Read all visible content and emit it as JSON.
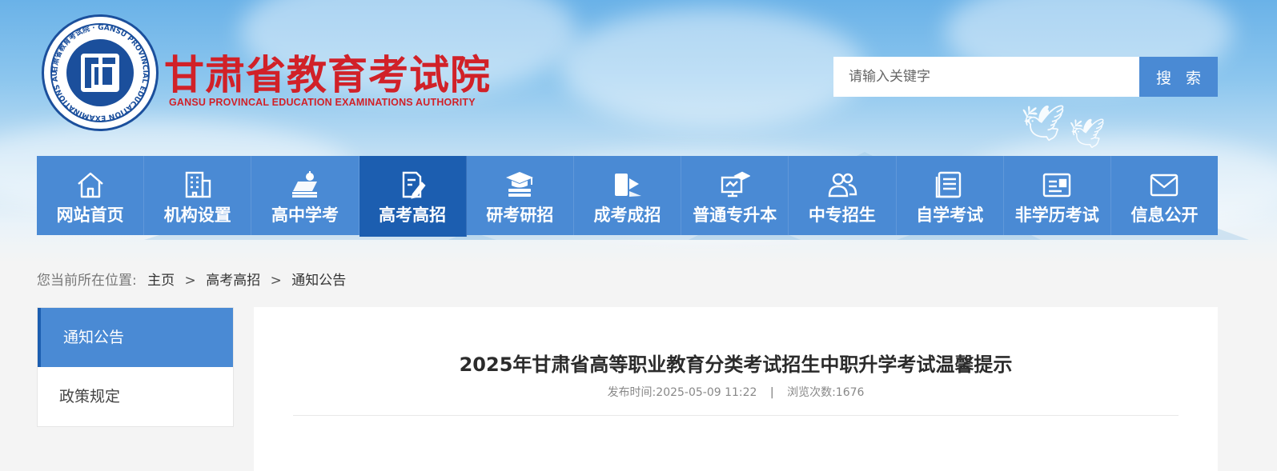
{
  "header": {
    "title": "甘肃省教育考试院",
    "subtitle": "GANSU PROVINCAL EDUCATION EXAMINATIONS AUTHORITY",
    "logo_ring_text": "甘肃省教育考试院 · GANSU PROVINCIAL EDUCATION EXAMINATIONS AUTHORITY",
    "title_color": "#d12128",
    "logo_color": "#1b4f9c"
  },
  "search": {
    "placeholder": "请输入关键字",
    "value": "",
    "button_label": "搜 索",
    "button_color": "#4a8ad4"
  },
  "nav": {
    "bg_color": "#4a8ad4",
    "active_color": "#1c5eb0",
    "items": [
      {
        "label": "网站首页",
        "icon": "home-icon"
      },
      {
        "label": "机构设置",
        "icon": "building-icon"
      },
      {
        "label": "高中学考",
        "icon": "books-apple-icon"
      },
      {
        "label": "高考高招",
        "icon": "document-pen-icon",
        "active": true
      },
      {
        "label": "研考研招",
        "icon": "graduation-cap-icon"
      },
      {
        "label": "成考成招",
        "icon": "book-flag-icon"
      },
      {
        "label": "普通专升本",
        "icon": "monitor-cap-icon"
      },
      {
        "label": "中专招生",
        "icon": "users-icon"
      },
      {
        "label": "自学考试",
        "icon": "notebook-icon"
      },
      {
        "label": "非学历考试",
        "icon": "id-card-icon"
      },
      {
        "label": "信息公开",
        "icon": "envelope-icon"
      }
    ]
  },
  "breadcrumb": {
    "label": "您当前所在位置:",
    "items": [
      "主页",
      "高考高招",
      "通知公告"
    ],
    "separator": ">"
  },
  "sidebar": {
    "items": [
      {
        "label": "通知公告",
        "active": true
      },
      {
        "label": "政策规定",
        "active": false
      }
    ]
  },
  "article": {
    "title": "2025年甘肃省高等职业教育分类考试招生中职升学考试温馨提示",
    "publish_label": "发布时间:",
    "publish_time": "2025-05-09 11:22",
    "divider": "|",
    "views_label": "浏览次数:",
    "views": "1676"
  }
}
